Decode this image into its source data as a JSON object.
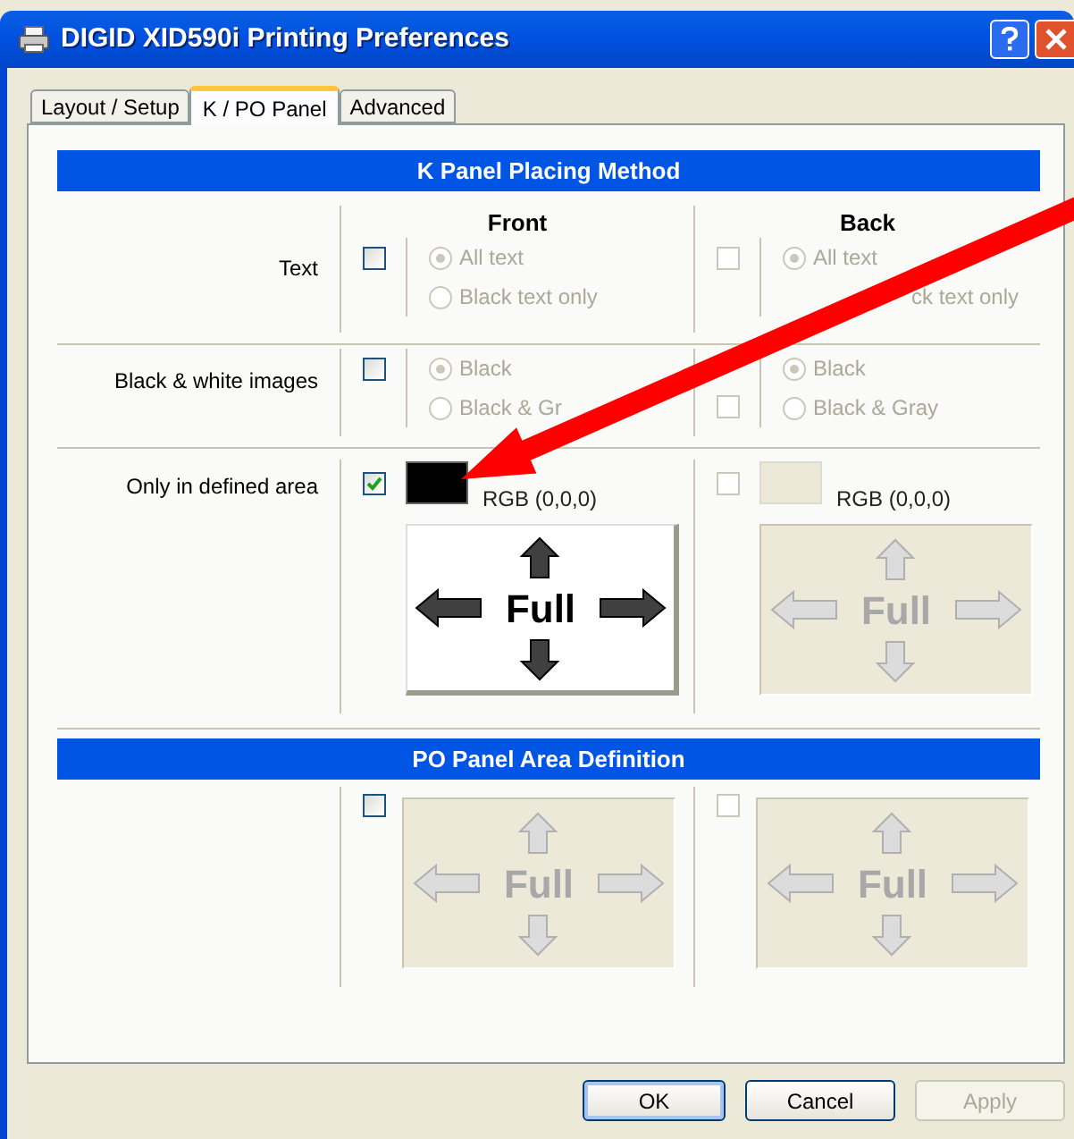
{
  "window": {
    "title": "DIGID XID590i Printing Preferences"
  },
  "tabs": [
    {
      "label": "Layout / Setup",
      "selected": false
    },
    {
      "label": "K / PO Panel",
      "selected": true
    },
    {
      "label": "Advanced",
      "selected": false
    }
  ],
  "placing_method": {
    "title": "K Panel Placing Method",
    "columns": [
      "Front",
      "Back"
    ],
    "rows": [
      {
        "label": "Text",
        "sides": [
          {
            "checked": false,
            "checkbox_disabled": false,
            "options_disabled": true,
            "options": [
              {
                "kind": "radio",
                "label": "All text",
                "selected": true
              },
              {
                "kind": "radio",
                "label": "Black text only",
                "selected": false
              }
            ]
          },
          {
            "checked": false,
            "checkbox_disabled": true,
            "options_disabled": true,
            "options": [
              {
                "kind": "radio",
                "label": "All text",
                "selected": true
              },
              {
                "kind": "partial",
                "label": "ck text only"
              }
            ]
          }
        ]
      },
      {
        "label": "Black & white images",
        "sides": [
          {
            "checked": false,
            "checkbox_disabled": false,
            "options_disabled": true,
            "options": [
              {
                "kind": "radio",
                "label": "Black",
                "selected": true
              },
              {
                "kind": "radio",
                "label": "Black & Gr",
                "selected": false
              }
            ]
          },
          {
            "checked": false,
            "checkbox_disabled": true,
            "options_disabled": true,
            "options": [
              {
                "kind": "radio",
                "label": "Black",
                "selected": true
              },
              {
                "kind": "radio",
                "label": "Black & Gray",
                "selected": false
              }
            ]
          }
        ]
      }
    ],
    "defined_area": {
      "label": "Only in defined area",
      "sides": [
        {
          "checked": true,
          "disabled": false,
          "color_label": "RGB (0,0,0)",
          "area": {
            "label": "Full",
            "disabled": false
          }
        },
        {
          "checked": false,
          "disabled": true,
          "color_label": "RGB (0,0,0)",
          "area": {
            "label": "Full",
            "disabled": true
          }
        }
      ]
    }
  },
  "po_panel": {
    "title": "PO Panel Area Definition",
    "sides": [
      {
        "checked": false,
        "checkbox_disabled": false,
        "area": {
          "label": "Full",
          "disabled": true
        }
      },
      {
        "checked": false,
        "checkbox_disabled": true,
        "area": {
          "label": "Full",
          "disabled": true
        }
      }
    ]
  },
  "buttons": [
    {
      "label": "OK",
      "kind": "default",
      "disabled": false
    },
    {
      "label": "Cancel",
      "kind": "normal",
      "disabled": false
    },
    {
      "label": "Apply",
      "kind": "normal",
      "disabled": true
    }
  ]
}
